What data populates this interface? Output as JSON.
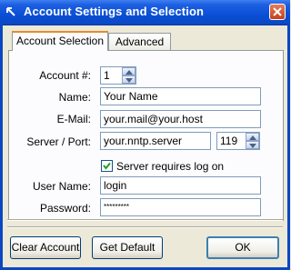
{
  "window": {
    "title": "Account Settings and Selection"
  },
  "tabs": [
    {
      "label": "Account Selection",
      "active": true
    },
    {
      "label": "Advanced",
      "active": false
    }
  ],
  "form": {
    "account_label": "Account #:",
    "account_value": "1",
    "name_label": "Name:",
    "name_value": "Your Name",
    "email_label": "E-Mail:",
    "email_value": "your.mail@your.host",
    "server_label": "Server / Port:",
    "server_value": "your.nntp.server",
    "port_value": "119",
    "requires_logon_label": "Server requires log on",
    "requires_logon_checked": true,
    "username_label": "User Name:",
    "username_value": "login",
    "password_label": "Password:",
    "password_value": "*********"
  },
  "buttons": {
    "clear": "Clear Account",
    "default": "Get Default",
    "ok": "OK"
  },
  "colors": {
    "titlebar": "#0a4fd6",
    "tab_highlight": "#e68b2c",
    "dialog_bg": "#ece9d8"
  },
  "icons": {
    "system": "window-menu-arrow-icon",
    "close": "close-icon"
  }
}
